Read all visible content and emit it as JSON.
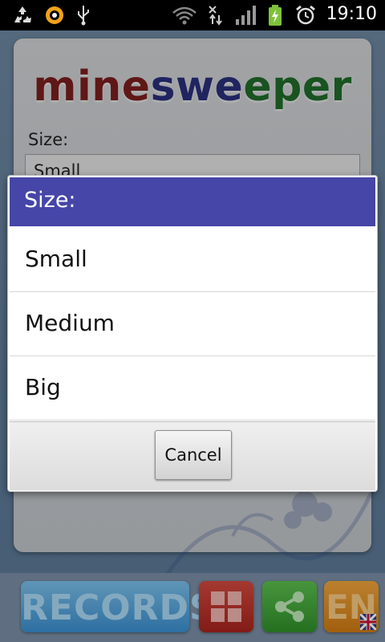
{
  "status_bar": {
    "time": "19:10",
    "icons": [
      "recycle-icon",
      "orange-ring-icon",
      "usb-icon",
      "wifi-icon",
      "data-arrows-icon",
      "signal-icon",
      "battery-charging-icon",
      "alarm-icon"
    ]
  },
  "app": {
    "logo": {
      "part1": "mine",
      "part2": "swe",
      "part3": "eper"
    },
    "size_label": "Size:",
    "size_value": "Small",
    "colors": {
      "logo_red": "#7a1e1e",
      "logo_blue": "#2a2f7a",
      "logo_green": "#1f6b2a"
    }
  },
  "toolbar": {
    "records_label": "RECORDS",
    "lang_label": "EN",
    "colors": {
      "records": "#3b8fd0",
      "grid": "#a7241d",
      "share": "#2f8f2a",
      "lang": "#cf7a12"
    }
  },
  "dialog": {
    "title": "Size:",
    "title_color": "#4645a8",
    "options": [
      "Small",
      "Medium",
      "Big"
    ],
    "cancel_label": "Cancel"
  }
}
